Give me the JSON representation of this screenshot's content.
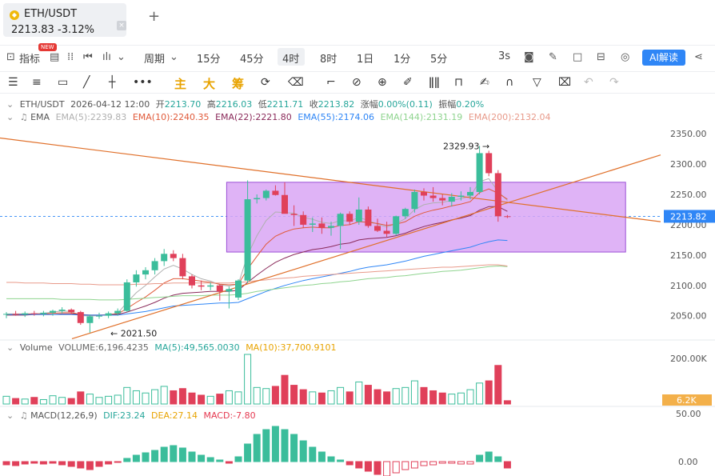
{
  "tab": {
    "symbol": "ETH/USDT",
    "price": "2213.83",
    "change": "-3.12%",
    "close": "×",
    "add": "+"
  },
  "toolbar1": {
    "indicator_label": "指标",
    "new_badge": "NEW",
    "period_label": "周期",
    "intervals": [
      "15分",
      "45分",
      "4时",
      "8时",
      "1日",
      "1分",
      "5分"
    ],
    "active_interval": "4时",
    "refresh": "3s",
    "ai_label": "AI解读"
  },
  "toolbar2": {
    "zhu": "主",
    "da": "大",
    "chou": "筹"
  },
  "info_main": {
    "symbol": "ETH/USDT",
    "time": "2026-04-12 12:00",
    "open_label": "开",
    "open": "2213.70",
    "high_label": "高",
    "high": "2216.03",
    "low_label": "低",
    "low": "2211.71",
    "close_label": "收",
    "close": "2213.82",
    "change_label": "涨幅",
    "change": "0.00%(0.11)",
    "amp_label": "振幅",
    "amp": "0.20%"
  },
  "ema_line": {
    "label": "EMA",
    "items": [
      {
        "text": "EMA(5):2239.83",
        "color": "#b0b0b0"
      },
      {
        "text": "EMA(10):2240.35",
        "color": "#e05a3a"
      },
      {
        "text": "EMA(22):2221.80",
        "color": "#8a2a5a"
      },
      {
        "text": "EMA(55):2174.06",
        "color": "#2f86f6"
      },
      {
        "text": "EMA(144):2131.19",
        "color": "#8fd48f"
      },
      {
        "text": "EMA(200):2132.04",
        "color": "#e89a8a"
      }
    ]
  },
  "volume_line": {
    "label": "Volume",
    "items": [
      {
        "text": "VOLUME:6,196.4235",
        "color": "#666666"
      },
      {
        "text": "MA(5):49,565.0030",
        "color": "#26a69a"
      },
      {
        "text": "MA(10):37,700.9101",
        "color": "#e8a300"
      }
    ]
  },
  "macd_line": {
    "label": "MACD(12,26,9)",
    "items": [
      {
        "text": "DIF:23.24",
        "color": "#26a69a"
      },
      {
        "text": "DEA:27.14",
        "color": "#e8a300"
      },
      {
        "text": "MACD:-7.80",
        "color": "#e53950"
      }
    ]
  },
  "price_axis": [
    "2350.00",
    "2300.00",
    "2250.00",
    "2200.00",
    "2150.00",
    "2100.00",
    "2050.00"
  ],
  "current_price_tag": "2213.82",
  "high_marker": "2329.93",
  "low_marker": "2021.50",
  "volume_axis": [
    "200.00K"
  ],
  "volume_tag": "6.2K",
  "macd_axis": [
    "50.00",
    "0.00"
  ],
  "colors": {
    "up": "#3bbd9b",
    "down": "#e0405a",
    "box_fill": "#d9a6f5",
    "box_stroke": "#9b4fd6"
  },
  "chart_data": {
    "type": "candlestick",
    "ylim": [
      2010,
      2370
    ],
    "candles": [
      {
        "o": 2052,
        "h": 2056,
        "l": 2046,
        "c": 2053
      },
      {
        "o": 2053,
        "h": 2058,
        "l": 2050,
        "c": 2052
      },
      {
        "o": 2052,
        "h": 2057,
        "l": 2048,
        "c": 2054
      },
      {
        "o": 2054,
        "h": 2058,
        "l": 2050,
        "c": 2053
      },
      {
        "o": 2053,
        "h": 2058,
        "l": 2049,
        "c": 2055
      },
      {
        "o": 2055,
        "h": 2060,
        "l": 2050,
        "c": 2058
      },
      {
        "o": 2058,
        "h": 2064,
        "l": 2054,
        "c": 2060
      },
      {
        "o": 2060,
        "h": 2062,
        "l": 2052,
        "c": 2056
      },
      {
        "o": 2056,
        "h": 2058,
        "l": 2035,
        "c": 2038
      },
      {
        "o": 2038,
        "h": 2052,
        "l": 2022,
        "c": 2049
      },
      {
        "o": 2049,
        "h": 2055,
        "l": 2045,
        "c": 2050
      },
      {
        "o": 2050,
        "h": 2057,
        "l": 2046,
        "c": 2054
      },
      {
        "o": 2054,
        "h": 2062,
        "l": 2050,
        "c": 2058
      },
      {
        "o": 2058,
        "h": 2110,
        "l": 2056,
        "c": 2105
      },
      {
        "o": 2105,
        "h": 2125,
        "l": 2098,
        "c": 2118
      },
      {
        "o": 2118,
        "h": 2130,
        "l": 2110,
        "c": 2125
      },
      {
        "o": 2125,
        "h": 2145,
        "l": 2118,
        "c": 2140
      },
      {
        "o": 2140,
        "h": 2160,
        "l": 2132,
        "c": 2152
      },
      {
        "o": 2152,
        "h": 2158,
        "l": 2140,
        "c": 2145
      },
      {
        "o": 2145,
        "h": 2152,
        "l": 2110,
        "c": 2115
      },
      {
        "o": 2115,
        "h": 2118,
        "l": 2095,
        "c": 2100
      },
      {
        "o": 2100,
        "h": 2108,
        "l": 2092,
        "c": 2098
      },
      {
        "o": 2098,
        "h": 2105,
        "l": 2092,
        "c": 2100
      },
      {
        "o": 2100,
        "h": 2102,
        "l": 2075,
        "c": 2090
      },
      {
        "o": 2090,
        "h": 2098,
        "l": 2062,
        "c": 2094
      },
      {
        "o": 2080,
        "h": 2110,
        "l": 2076,
        "c": 2108
      },
      {
        "o": 2108,
        "h": 2273,
        "l": 2104,
        "c": 2242
      },
      {
        "o": 2242,
        "h": 2250,
        "l": 2235,
        "c": 2244
      },
      {
        "o": 2244,
        "h": 2258,
        "l": 2240,
        "c": 2256
      },
      {
        "o": 2256,
        "h": 2265,
        "l": 2248,
        "c": 2249
      },
      {
        "o": 2249,
        "h": 2270,
        "l": 2240,
        "c": 2218
      },
      {
        "o": 2218,
        "h": 2232,
        "l": 2198,
        "c": 2216
      },
      {
        "o": 2216,
        "h": 2222,
        "l": 2195,
        "c": 2200
      },
      {
        "o": 2200,
        "h": 2212,
        "l": 2188,
        "c": 2202
      },
      {
        "o": 2202,
        "h": 2212,
        "l": 2185,
        "c": 2195
      },
      {
        "o": 2195,
        "h": 2205,
        "l": 2182,
        "c": 2198
      },
      {
        "o": 2198,
        "h": 2220,
        "l": 2160,
        "c": 2218
      },
      {
        "o": 2218,
        "h": 2222,
        "l": 2200,
        "c": 2205
      },
      {
        "o": 2205,
        "h": 2245,
        "l": 2200,
        "c": 2225
      },
      {
        "o": 2225,
        "h": 2230,
        "l": 2195,
        "c": 2198
      },
      {
        "o": 2198,
        "h": 2210,
        "l": 2188,
        "c": 2190
      },
      {
        "o": 2190,
        "h": 2205,
        "l": 2180,
        "c": 2185
      },
      {
        "o": 2185,
        "h": 2215,
        "l": 2182,
        "c": 2214
      },
      {
        "o": 2214,
        "h": 2228,
        "l": 2210,
        "c": 2226
      },
      {
        "o": 2226,
        "h": 2258,
        "l": 2220,
        "c": 2254
      },
      {
        "o": 2254,
        "h": 2260,
        "l": 2240,
        "c": 2248
      },
      {
        "o": 2248,
        "h": 2262,
        "l": 2238,
        "c": 2244
      },
      {
        "o": 2244,
        "h": 2250,
        "l": 2232,
        "c": 2240
      },
      {
        "o": 2238,
        "h": 2252,
        "l": 2230,
        "c": 2246
      },
      {
        "o": 2246,
        "h": 2255,
        "l": 2240,
        "c": 2248
      },
      {
        "o": 2248,
        "h": 2262,
        "l": 2242,
        "c": 2254
      },
      {
        "o": 2254,
        "h": 2330,
        "l": 2250,
        "c": 2318
      },
      {
        "o": 2318,
        "h": 2322,
        "l": 2280,
        "c": 2285
      },
      {
        "o": 2285,
        "h": 2290,
        "l": 2205,
        "c": 2214
      },
      {
        "o": 2214,
        "h": 2216,
        "l": 2211,
        "c": 2213
      }
    ],
    "volume": [
      14,
      10,
      9,
      12,
      8,
      15,
      12,
      10,
      22,
      18,
      12,
      14,
      16,
      30,
      24,
      20,
      26,
      32,
      24,
      28,
      20,
      16,
      14,
      18,
      24,
      22,
      90,
      30,
      28,
      32,
      52,
      34,
      26,
      22,
      20,
      24,
      30,
      22,
      40,
      34,
      26,
      22,
      28,
      30,
      42,
      30,
      24,
      20,
      18,
      20,
      26,
      38,
      42,
      70,
      6
    ],
    "macd_hist": [
      -4,
      -5,
      -3,
      -2,
      -3,
      -2,
      -4,
      -6,
      -8,
      -10,
      -6,
      -3,
      -1,
      4,
      8,
      11,
      14,
      18,
      20,
      17,
      12,
      8,
      5,
      2,
      -2,
      6,
      22,
      34,
      40,
      44,
      40,
      34,
      26,
      18,
      12,
      6,
      2,
      -4,
      -8,
      -12,
      -16,
      -18,
      -14,
      -10,
      -8,
      -5,
      -4,
      -2,
      -2,
      -3,
      -3,
      8,
      12,
      6,
      -8
    ],
    "ema": [
      {
        "name": "EMA(5)",
        "color": "#b0b0b0",
        "values": [
          2053,
          2053,
          2053,
          2053,
          2054,
          2056,
          2058,
          2057,
          2050,
          2050,
          2050,
          2052,
          2054,
          2072,
          2088,
          2100,
          2114,
          2127,
          2133,
          2127,
          2118,
          2111,
          2107,
          2101,
          2099,
          2102,
          2150,
          2182,
          2207,
          2221,
          2220,
          2219,
          2212,
          2209,
          2204,
          2202,
          2207,
          2206,
          2212,
          2207,
          2201,
          2196,
          2202,
          2210,
          2225,
          2233,
          2236,
          2237,
          2240,
          2243,
          2247,
          2271,
          2276,
          2255,
          2240
        ]
      },
      {
        "name": "EMA(10)",
        "color": "#e05a3a",
        "values": [
          2052,
          2052,
          2053,
          2053,
          2053,
          2054,
          2055,
          2055,
          2052,
          2051,
          2051,
          2052,
          2053,
          2062,
          2072,
          2081,
          2092,
          2104,
          2111,
          2111,
          2109,
          2107,
          2105,
          2102,
          2101,
          2102,
          2127,
          2148,
          2168,
          2181,
          2188,
          2193,
          2195,
          2196,
          2195,
          2195,
          2199,
          2200,
          2205,
          2204,
          2202,
          2199,
          2201,
          2205,
          2214,
          2220,
          2224,
          2227,
          2231,
          2234,
          2238,
          2253,
          2259,
          2252,
          2242
        ]
      },
      {
        "name": "EMA(22)",
        "color": "#8a2a5a",
        "values": [
          2051,
          2051,
          2051,
          2052,
          2052,
          2052,
          2053,
          2053,
          2052,
          2051,
          2051,
          2051,
          2052,
          2056,
          2061,
          2066,
          2072,
          2079,
          2084,
          2087,
          2088,
          2089,
          2090,
          2090,
          2090,
          2092,
          2105,
          2117,
          2128,
          2138,
          2145,
          2151,
          2155,
          2159,
          2161,
          2164,
          2168,
          2170,
          2175,
          2177,
          2178,
          2179,
          2182,
          2186,
          2192,
          2197,
          2201,
          2204,
          2208,
          2211,
          2215,
          2224,
          2230,
          2230,
          2222
        ]
      },
      {
        "name": "EMA(55)",
        "color": "#2f86f6",
        "values": [
          2052,
          2052,
          2052,
          2052,
          2052,
          2052,
          2052,
          2052,
          2051,
          2051,
          2051,
          2051,
          2051,
          2053,
          2055,
          2057,
          2060,
          2063,
          2066,
          2067,
          2068,
          2069,
          2070,
          2071,
          2071,
          2072,
          2078,
          2084,
          2090,
          2095,
          2100,
          2104,
          2108,
          2111,
          2114,
          2117,
          2120,
          2123,
          2127,
          2130,
          2132,
          2134,
          2137,
          2140,
          2144,
          2148,
          2151,
          2154,
          2157,
          2160,
          2163,
          2168,
          2172,
          2175,
          2174
        ]
      },
      {
        "name": "EMA(144)",
        "color": "#8fd48f",
        "values": [
          2078,
          2078,
          2078,
          2078,
          2078,
          2078,
          2077,
          2077,
          2077,
          2077,
          2076,
          2076,
          2076,
          2077,
          2078,
          2079,
          2080,
          2081,
          2082,
          2083,
          2083,
          2083,
          2084,
          2084,
          2084,
          2085,
          2087,
          2090,
          2092,
          2094,
          2096,
          2098,
          2100,
          2101,
          2103,
          2104,
          2106,
          2107,
          2109,
          2111,
          2112,
          2113,
          2115,
          2116,
          2118,
          2120,
          2121,
          2123,
          2124,
          2125,
          2127,
          2129,
          2131,
          2132,
          2131
        ]
      },
      {
        "name": "EMA(200)",
        "color": "#e89a8a",
        "values": [
          2105,
          2105,
          2104,
          2104,
          2104,
          2103,
          2103,
          2103,
          2102,
          2102,
          2101,
          2101,
          2101,
          2101,
          2102,
          2102,
          2103,
          2103,
          2104,
          2104,
          2104,
          2104,
          2104,
          2104,
          2104,
          2105,
          2106,
          2108,
          2109,
          2111,
          2112,
          2113,
          2115,
          2116,
          2117,
          2118,
          2119,
          2120,
          2121,
          2122,
          2123,
          2124,
          2125,
          2126,
          2127,
          2128,
          2129,
          2130,
          2130,
          2131,
          2132,
          2133,
          2134,
          2134,
          2132
        ]
      }
    ]
  }
}
